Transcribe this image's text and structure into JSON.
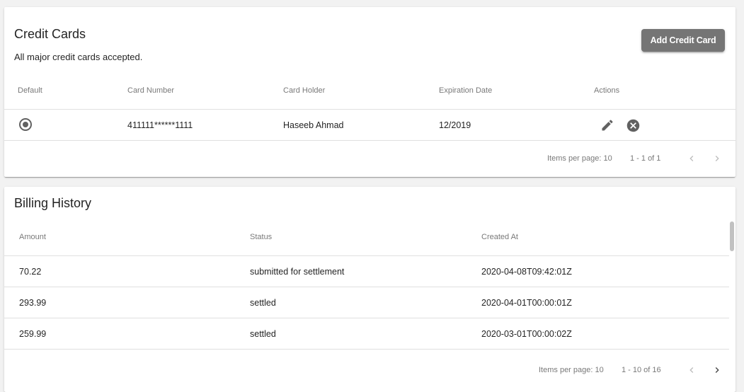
{
  "credit_cards": {
    "title": "Credit Cards",
    "subtitle": "All major credit cards accepted.",
    "add_button_label": "Add Credit Card",
    "columns": [
      "Default",
      "Card Number",
      "Card Holder",
      "Expiration Date",
      "Actions"
    ],
    "rows": [
      {
        "card_number": "411111******1111",
        "card_holder": "Haseeb Ahmad",
        "expiration": "12/2019",
        "is_default": true
      }
    ],
    "paginator": {
      "items_per_page_label": "Items per page: 10",
      "range_label": "1 - 1 of 1"
    }
  },
  "billing_history": {
    "title": "Billing History",
    "columns": [
      "Amount",
      "Status",
      "Created At"
    ],
    "rows": [
      {
        "amount": "70.22",
        "status": "submitted for settlement",
        "created_at": "2020-04-08T09:42:01Z"
      },
      {
        "amount": "293.99",
        "status": "settled",
        "created_at": "2020-04-01T00:00:01Z"
      },
      {
        "amount": "259.99",
        "status": "settled",
        "created_at": "2020-03-01T00:00:02Z"
      }
    ],
    "paginator": {
      "items_per_page_label": "Items per page: 10",
      "range_label": "1 - 10 of 16"
    }
  },
  "icons": {
    "edit": "pencil-icon",
    "delete": "cancel-circle-icon",
    "prev": "chevron-left-icon",
    "next": "chevron-right-icon"
  },
  "colors": {
    "button_bg": "#757575",
    "icon": "#616161",
    "divider": "#e0e0e0"
  }
}
